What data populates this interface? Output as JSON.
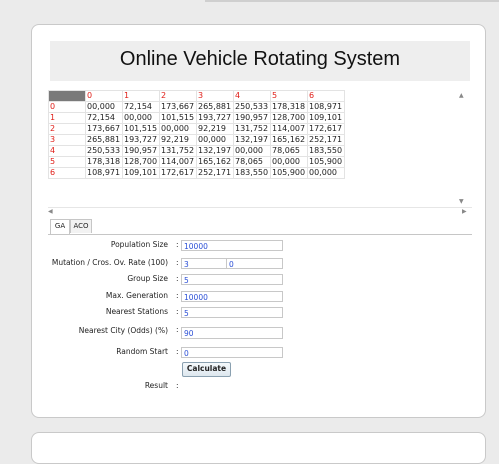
{
  "title": "Online Vehicle Rotating System",
  "matrix": {
    "col_headers": [
      "0",
      "1",
      "2",
      "3",
      "4",
      "5",
      "6"
    ],
    "rows": [
      {
        "label": "0",
        "cells": [
          "00,000",
          "72,154",
          "173,667",
          "265,881",
          "250,533",
          "178,318",
          "108,971"
        ]
      },
      {
        "label": "1",
        "cells": [
          "72,154",
          "00,000",
          "101,515",
          "193,727",
          "190,957",
          "128,700",
          "109,101"
        ]
      },
      {
        "label": "2",
        "cells": [
          "173,667",
          "101,515",
          "00,000",
          "92,219",
          "131,752",
          "114,007",
          "172,617"
        ]
      },
      {
        "label": "3",
        "cells": [
          "265,881",
          "193,727",
          "92,219",
          "00,000",
          "132,197",
          "165,162",
          "252,171"
        ]
      },
      {
        "label": "4",
        "cells": [
          "250,533",
          "190,957",
          "131,752",
          "132,197",
          "00,000",
          "78,065",
          "183,550"
        ]
      },
      {
        "label": "5",
        "cells": [
          "178,318",
          "128,700",
          "114,007",
          "165,162",
          "78,065",
          "00,000",
          "105,900"
        ]
      },
      {
        "label": "6",
        "cells": [
          "108,971",
          "109,101",
          "172,617",
          "252,171",
          "183,550",
          "105,900",
          "00,000"
        ]
      }
    ]
  },
  "tabs": [
    {
      "label": "GA",
      "active": true
    },
    {
      "label": "ACO",
      "active": false
    }
  ],
  "form": {
    "population_size": {
      "label": "Population Size",
      "value": "10000"
    },
    "mutation_rate": {
      "label": "Mutation / Cros. Ov. Rate (100)",
      "value": "3",
      "value2": "0"
    },
    "group_size": {
      "label": "Group Size",
      "value": "5"
    },
    "max_generation": {
      "label": "Max. Generation",
      "value": "10000"
    },
    "nearest_stations": {
      "label": "Nearest Stations",
      "value": "5"
    },
    "nearest_city": {
      "label": "Nearest City (Odds) (%)",
      "value": "90"
    },
    "random_start": {
      "label": "Random Start",
      "value": "0"
    },
    "calculate_label": "Calculate",
    "result_label": "Result",
    "colon": ":"
  },
  "colors": {
    "header_red": "#e0201a",
    "value_blue": "#2b4fd6",
    "corner": "#7a7a7a"
  },
  "icons": {
    "scroll_up": "▲",
    "scroll_down": "▼",
    "scroll_left": "◀",
    "scroll_right": "▶"
  }
}
